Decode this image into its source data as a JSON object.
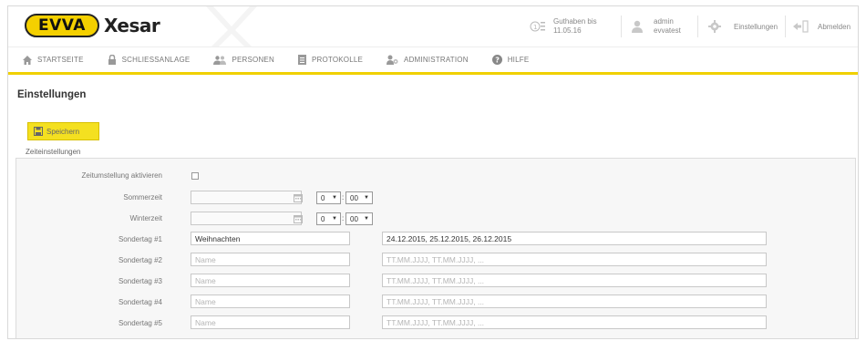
{
  "header": {
    "logo_badge": "EVVA",
    "logo_text": "Xesar",
    "credit_line1": "Guthaben bis",
    "credit_line2": "11.05.16",
    "user_name": "admin",
    "user_account": "evvatest",
    "settings_label": "Einstellungen",
    "logout_label": "Abmelden"
  },
  "nav": {
    "items": [
      {
        "label": "STARTSEITE",
        "icon": "home-icon"
      },
      {
        "label": "SCHLIESSANLAGE",
        "icon": "lock-icon"
      },
      {
        "label": "PERSONEN",
        "icon": "persons-icon"
      },
      {
        "label": "PROTOKOLLE",
        "icon": "document-icon"
      },
      {
        "label": "ADMINISTRATION",
        "icon": "admin-icon"
      },
      {
        "label": "HILFE",
        "icon": "help-icon"
      }
    ]
  },
  "page": {
    "title": "Einstellungen",
    "save_label": "Speichern",
    "section_label": "Zeiteinstellungen"
  },
  "time": {
    "dst_label": "Zeitumstellung aktivieren",
    "summer_label": "Sommerzeit",
    "winter_label": "Winterzeit",
    "summer_hour": "0",
    "summer_min": "00",
    "winter_hour": "0",
    "winter_min": "00"
  },
  "special_days": [
    {
      "label": "Sondertag #1",
      "name": "Weihnachten",
      "name_placeholder": "Name",
      "dates": "24.12.2015, 25.12.2015, 26.12.2015",
      "dates_placeholder": "TT.MM.JJJJ, TT.MM.JJJJ, ..."
    },
    {
      "label": "Sondertag #2",
      "name": "",
      "name_placeholder": "Name",
      "dates": "",
      "dates_placeholder": "TT.MM.JJJJ, TT.MM.JJJJ, ..."
    },
    {
      "label": "Sondertag #3",
      "name": "",
      "name_placeholder": "Name",
      "dates": "",
      "dates_placeholder": "TT.MM.JJJJ, TT.MM.JJJJ, ..."
    },
    {
      "label": "Sondertag #4",
      "name": "",
      "name_placeholder": "Name",
      "dates": "",
      "dates_placeholder": "TT.MM.JJJJ, TT.MM.JJJJ, ..."
    },
    {
      "label": "Sondertag #5",
      "name": "",
      "name_placeholder": "Name",
      "dates": "",
      "dates_placeholder": "TT.MM.JJJJ, TT.MM.JJJJ, ..."
    }
  ],
  "colors": {
    "brand_yellow": "#f4d000",
    "button_yellow": "#f4e020"
  }
}
